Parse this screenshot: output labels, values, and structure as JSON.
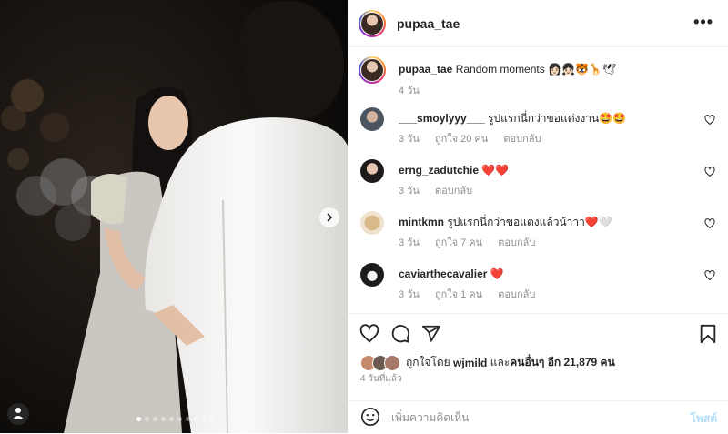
{
  "post": {
    "username": "pupaa_tae",
    "more_label": "•••"
  },
  "caption": {
    "username": "pupaa_tae",
    "text": "Random moments",
    "emojis": "👩🏻👧🏻🐯🦒🕊",
    "time": "4 วัน"
  },
  "comments": [
    {
      "username": "___smoylyyy___",
      "text": "รูปแรกนี่กว่าขอแต่งงาน",
      "emojis": "🤩🤩",
      "time": "3 วัน",
      "likes": "ถูกใจ 20 คน",
      "reply": "ตอบกลับ"
    },
    {
      "username": "erng_zadutchie",
      "text": "",
      "emojis": "❤️❤️",
      "time": "3 วัน",
      "likes": "",
      "reply": "ตอบกลับ"
    },
    {
      "username": "mintkmn",
      "text": "รูปแรกนี่กว่าขอแตงแล้วน้าาา",
      "emojis": "❤️🤍",
      "time": "3 วัน",
      "likes": "ถูกใจ 7 คน",
      "reply": "ตอบกลับ"
    },
    {
      "username": "caviarthecavalier",
      "text": "",
      "emojis": "❤️",
      "time": "3 วัน",
      "likes": "ถูกใจ 1 คน",
      "reply": "ตอบกลับ"
    }
  ],
  "likes": {
    "prefix": "ถูกใจโดย",
    "user": "wjmild",
    "middle": "และ",
    "others": "คนอื่นๆ อีก 21,879 คน"
  },
  "timestamp": "4 วันที่แล้ว",
  "add_comment": {
    "placeholder": "เพิ่มความคิดเห็น",
    "post_label": "โพสต์"
  },
  "carousel": {
    "total_slides": 10,
    "active_slide": 1
  },
  "colors": {
    "heart_red": "#ed4956",
    "post_button_disabled": "#b2dffc",
    "meta_gray": "#8e8e8e"
  }
}
